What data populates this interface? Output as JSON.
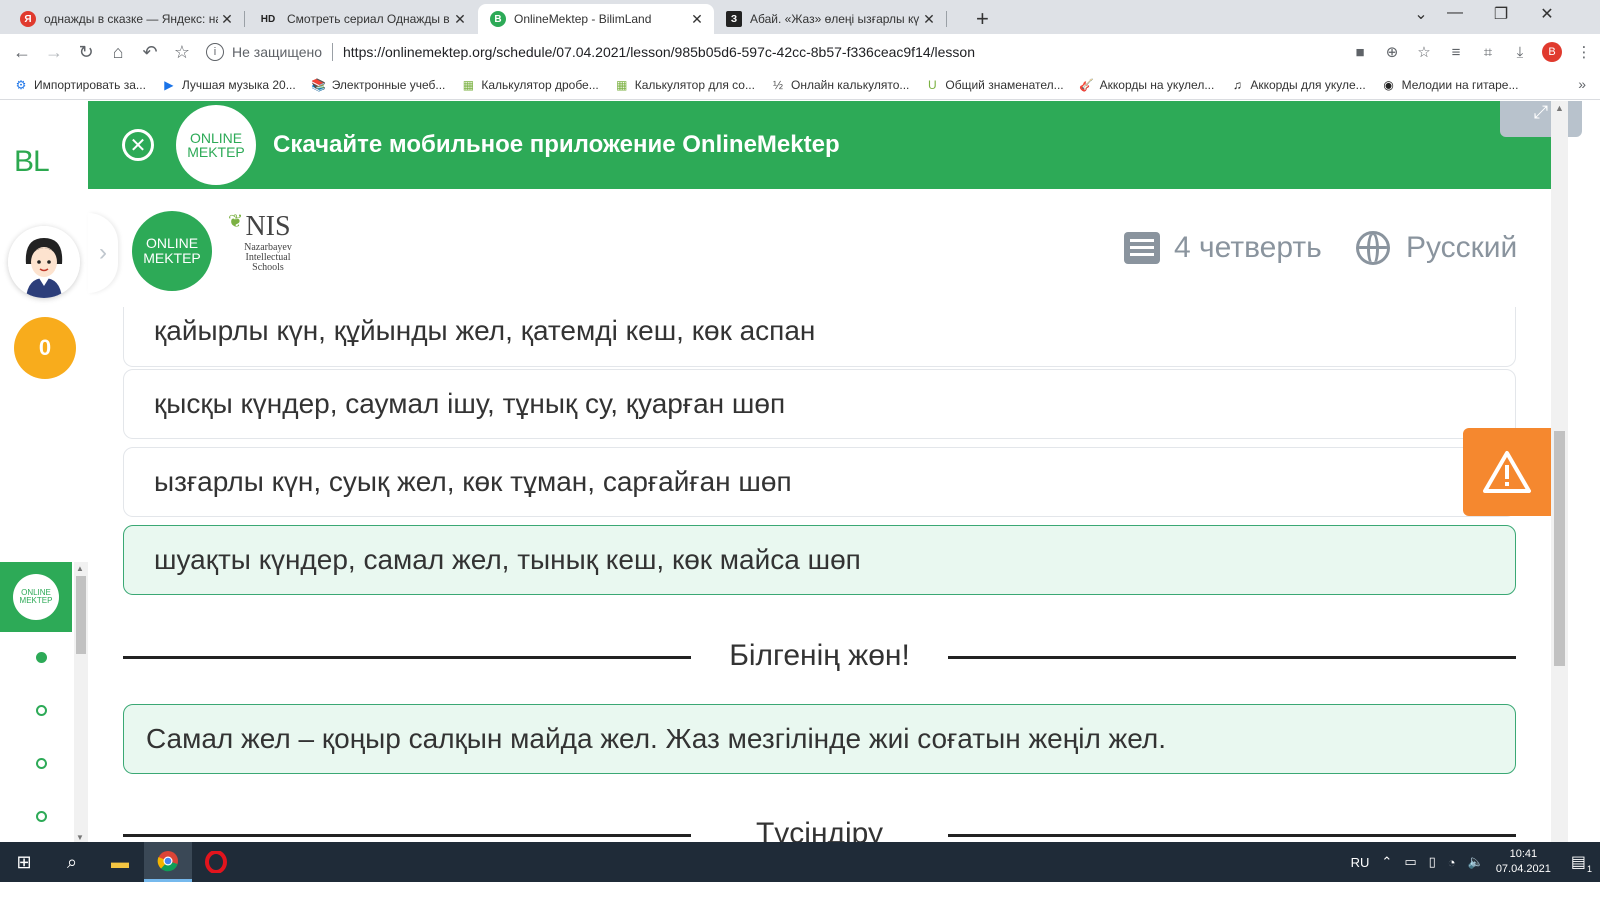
{
  "browser": {
    "tabs": [
      {
        "title": "однажды в сказке — Яндекс: на",
        "favicon": "Я",
        "favicon_color": "#e03a2e",
        "active": false
      },
      {
        "title": "Смотреть сериал Однажды в ск",
        "favicon": "HD",
        "favicon_color": "#222222",
        "active": false
      },
      {
        "title": "OnlineMektep - BilimLand",
        "favicon": "B",
        "favicon_color": "#2daa57",
        "active": true
      },
      {
        "title": "Абай. «Жаз» өлеңі ызғарлы күн",
        "favicon": "З",
        "favicon_color": "#222222",
        "active": false
      }
    ],
    "new_tab_symbol": "+",
    "address": {
      "security_text": "Не защищено",
      "url": "https://onlinemektep.org/schedule/07.04.2021/lesson/985b05d6-597c-42cc-8b57-f336ceac9f14/lesson"
    },
    "profile_letter": "B",
    "bookmarks": [
      {
        "label": "Импортировать за...",
        "icon": "gear-icon",
        "glyph": "⚙",
        "color": "#1a73e8"
      },
      {
        "label": "Лучшая музыка 20...",
        "icon": "play-icon",
        "glyph": "▶",
        "color": "#1a73e8"
      },
      {
        "label": "Электронные учеб...",
        "icon": "book-icon",
        "glyph": "📚",
        "color": "#555555"
      },
      {
        "label": "Калькулятор дробе...",
        "icon": "calculator-icon",
        "glyph": "▦",
        "color": "#7bb142"
      },
      {
        "label": "Калькулятор для со...",
        "icon": "calculator-icon",
        "glyph": "▦",
        "color": "#7bb142"
      },
      {
        "label": "Онлайн калькулято...",
        "icon": "fraction-icon",
        "glyph": "½",
        "color": "#555555"
      },
      {
        "label": "Общий знаменател...",
        "icon": "u-icon",
        "glyph": "U",
        "color": "#7bb142"
      },
      {
        "label": "Аккорды на укулел...",
        "icon": "ukulele-icon",
        "glyph": "🎸",
        "color": "#c2622d"
      },
      {
        "label": "Аккорды для укуле...",
        "icon": "music-note-icon",
        "glyph": "♫",
        "color": "#222222"
      },
      {
        "label": "Мелодии на гитаре...",
        "icon": "globe-icon",
        "glyph": "◉",
        "color": "#222222"
      }
    ]
  },
  "sidebar": {
    "logo": "BL",
    "score": "0",
    "om_logo_top": "ONLINE",
    "om_logo_bottom": "MEKTEP"
  },
  "banner": {
    "close_symbol": "✕",
    "logo_top": "ONLINE",
    "logo_bottom": "MEKTEP",
    "message": "Скачайте мобильное приложение OnlineMektep"
  },
  "header": {
    "om_logo_top": "ONLINE",
    "om_logo_bottom": "MEKTEP",
    "nis_big": "NIS",
    "nis_line1": "Nazarbayev",
    "nis_line2": "Intellectual",
    "nis_line3": "Schools",
    "quarter": "4 четверть",
    "language": "Русский"
  },
  "answers": [
    {
      "text": "қайырлы күн, құйынды жел, қатемді кеш, көк аспан",
      "selected": false
    },
    {
      "text": "қысқы күндер, саумал ішу, тұнық су, қуарған шөп",
      "selected": false
    },
    {
      "text": "ызғарлы күн, суық жел, көк тұман, сарғайған шөп",
      "selected": false
    },
    {
      "text": "шуақты күндер, самал жел, тынық кеш, көк майса шөп",
      "selected": true
    }
  ],
  "sections": {
    "know_title": "Білгенің жөн!",
    "know_text": "Самал жел – қоңыр салқын майда жел. Жаз мезгілінде жиі соғатын жеңіл жел.",
    "explain_title": "Түсіндіру"
  },
  "taskbar": {
    "language": "RU",
    "time": "10:41",
    "date": "07.04.2021",
    "notifications": "1"
  }
}
